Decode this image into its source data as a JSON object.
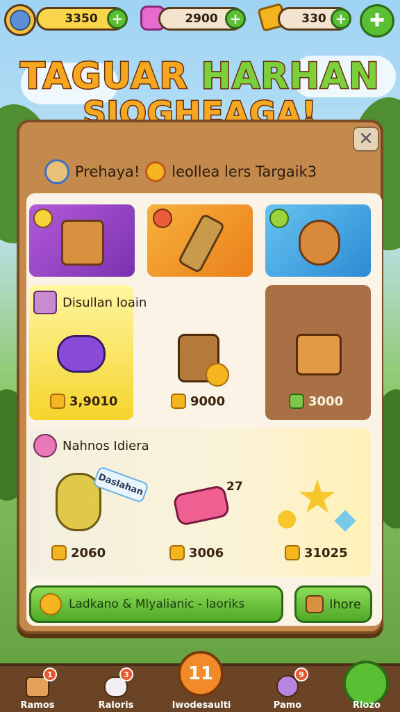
{
  "hud": {
    "coins": "3350",
    "gems": "2900",
    "tickets": "330",
    "plus": "+"
  },
  "title": {
    "line1_a": "TAGUAR",
    "line1_b": "HARHAN",
    "line2": "SIOGHEAGA!"
  },
  "panel": {
    "close": "✕",
    "subtitle_a": "Prehaya!",
    "subtitle_b": "leollea lers Targaik3"
  },
  "sections": {
    "featured_label": "Disullan loain",
    "bundles_label": "Nahnos Idiera"
  },
  "prices": {
    "featured_1": "3,9010",
    "featured_2": "9000",
    "featured_3": "3000",
    "bundle_1": "2060",
    "bundle_2": "3006",
    "bundle_3": "31025"
  },
  "tags": {
    "bundle_1_tag": "Daslahan",
    "bundle_2_tag": "27"
  },
  "buttons": {
    "main": "Ladkano & Mlyalianic - laoriks",
    "more": "Ihore"
  },
  "nav": {
    "items": [
      {
        "label": "Ramos",
        "badge": "1"
      },
      {
        "label": "Raloris",
        "badge": "3"
      },
      {
        "label": "Iwodesaulti",
        "center": "11"
      },
      {
        "label": "Pamo",
        "badge": "9"
      },
      {
        "label": "Rlozo"
      }
    ]
  },
  "colors": {
    "panel": "#c48a4d",
    "accent_green": "#5bbf34",
    "coin_gold": "#f4b51f"
  }
}
